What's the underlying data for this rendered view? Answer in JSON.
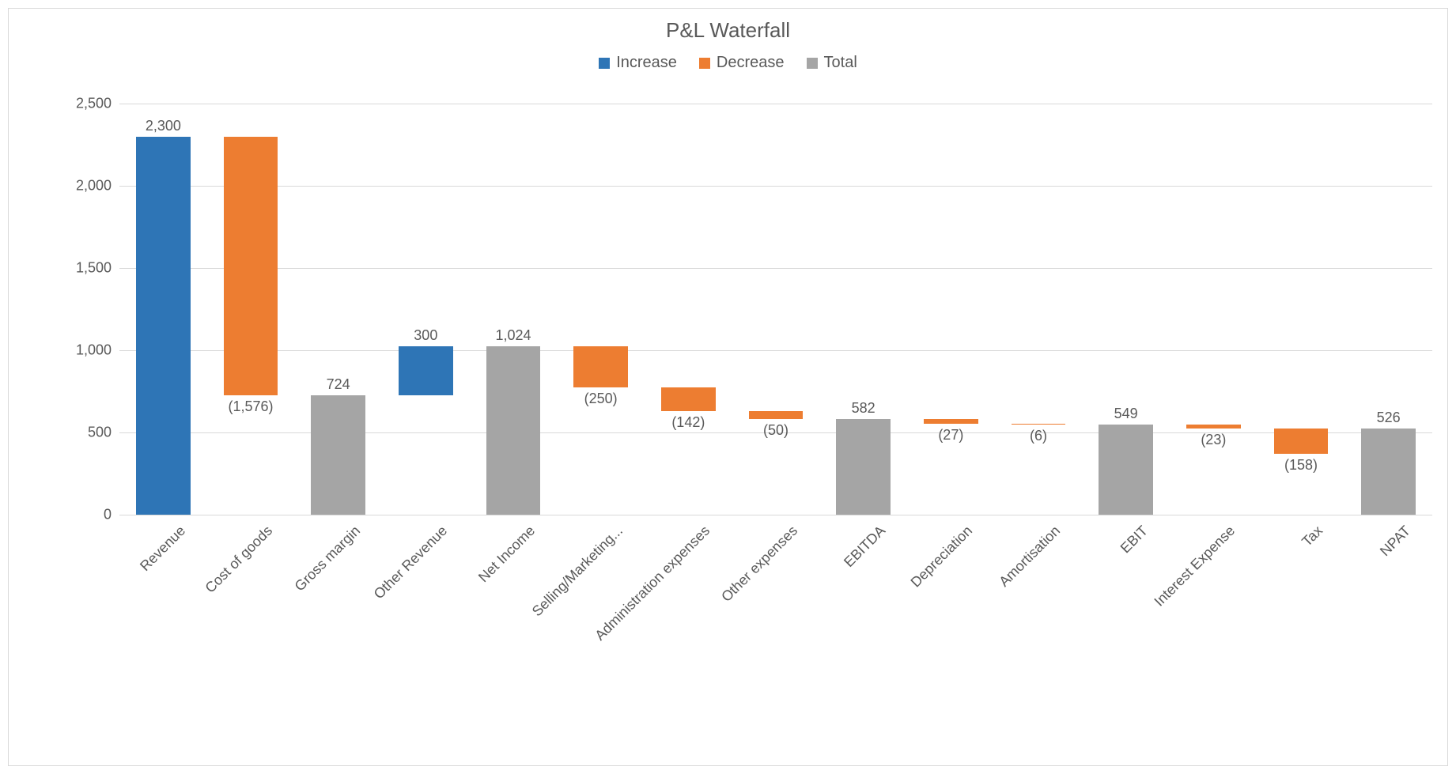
{
  "chart_data": {
    "type": "waterfall",
    "title": "P&L Waterfall",
    "ylabel": "",
    "xlabel": "",
    "ylim": [
      0,
      2500
    ],
    "yticks": [
      0,
      500,
      1000,
      1500,
      2000,
      2500
    ],
    "ytick_labels": [
      "0",
      "500",
      "1,000",
      "1,500",
      "2,000",
      "2,500"
    ],
    "legend": [
      {
        "name": "Increase",
        "color": "#2E75B6"
      },
      {
        "name": "Decrease",
        "color": "#ED7D31"
      },
      {
        "name": "Total",
        "color": "#A5A5A5"
      }
    ],
    "colors": {
      "increase": "#2E75B6",
      "decrease": "#ED7D31",
      "total": "#A5A5A5"
    },
    "items": [
      {
        "category": "Revenue",
        "value": 2300,
        "label": "2,300",
        "kind": "increase",
        "base": 0,
        "top": 2300
      },
      {
        "category": "Cost of goods",
        "value": -1576,
        "label": "(1,576)",
        "kind": "decrease",
        "base": 724,
        "top": 2300
      },
      {
        "category": "Gross margin",
        "value": 724,
        "label": "724",
        "kind": "total",
        "base": 0,
        "top": 724
      },
      {
        "category": "Other Revenue",
        "value": 300,
        "label": "300",
        "kind": "increase",
        "base": 724,
        "top": 1024
      },
      {
        "category": "Net Income",
        "value": 1024,
        "label": "1,024",
        "kind": "total",
        "base": 0,
        "top": 1024
      },
      {
        "category": "Selling/Marketing...",
        "value": -250,
        "label": "(250)",
        "kind": "decrease",
        "base": 774,
        "top": 1024
      },
      {
        "category": "Administration expenses",
        "value": -142,
        "label": "(142)",
        "kind": "decrease",
        "base": 632,
        "top": 774
      },
      {
        "category": "Other expenses",
        "value": -50,
        "label": "(50)",
        "kind": "decrease",
        "base": 582,
        "top": 632
      },
      {
        "category": "EBITDA",
        "value": 582,
        "label": "582",
        "kind": "total",
        "base": 0,
        "top": 582
      },
      {
        "category": "Depreciation",
        "value": -27,
        "label": "(27)",
        "kind": "decrease",
        "base": 555,
        "top": 582
      },
      {
        "category": "Amortisation",
        "value": -6,
        "label": "(6)",
        "kind": "decrease",
        "base": 549,
        "top": 555
      },
      {
        "category": "EBIT",
        "value": 549,
        "label": "549",
        "kind": "total",
        "base": 0,
        "top": 549
      },
      {
        "category": "Interest Expense",
        "value": -23,
        "label": "(23)",
        "kind": "decrease",
        "base": 526,
        "top": 549
      },
      {
        "category": "Tax",
        "value": -158,
        "label": "(158)",
        "kind": "decrease",
        "base": 368,
        "top": 526
      },
      {
        "category": "NPAT",
        "value": 526,
        "label": "526",
        "kind": "total",
        "base": 0,
        "top": 526
      }
    ]
  }
}
